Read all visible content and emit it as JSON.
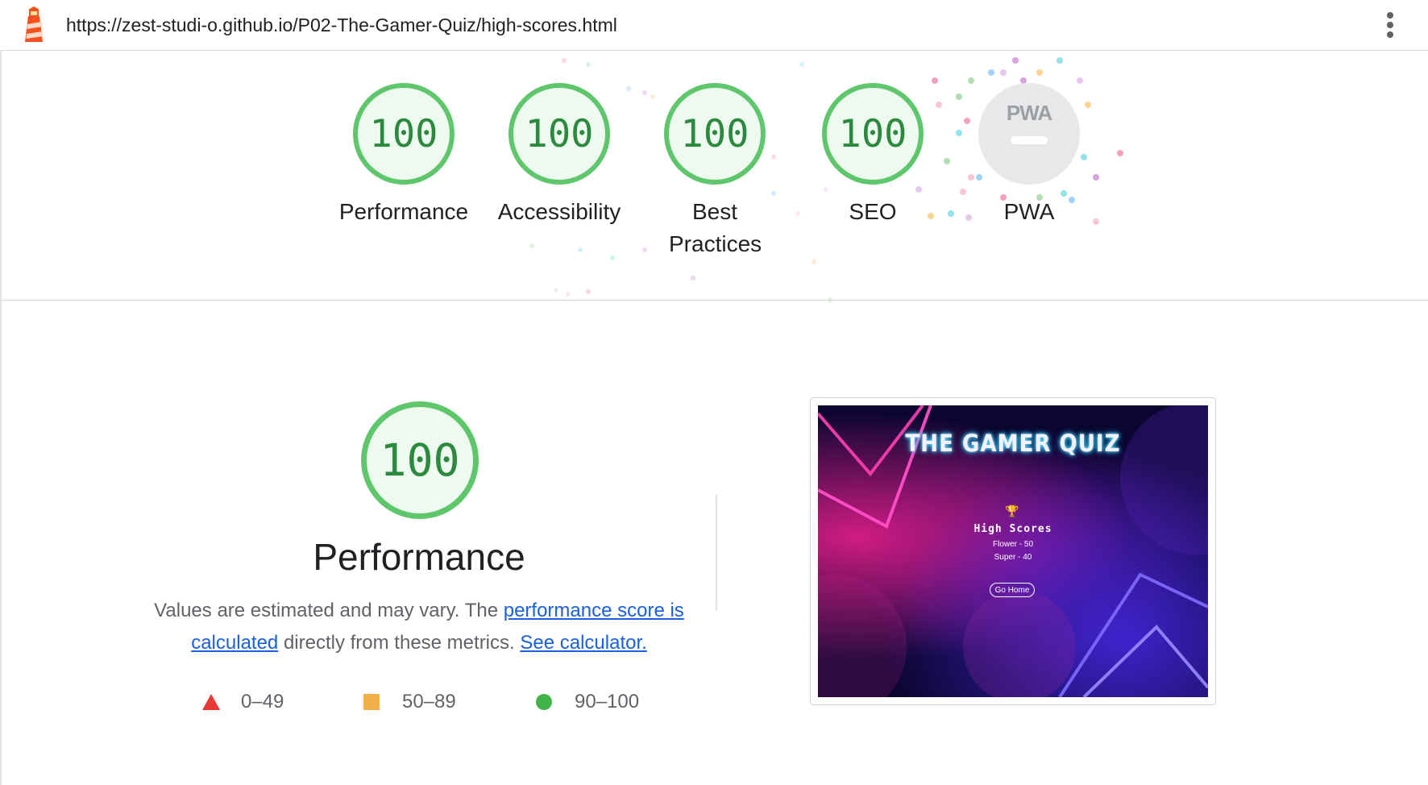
{
  "header": {
    "url": "https://zest-studi-o.github.io/P02-The-Gamer-Quiz/high-scores.html"
  },
  "gauges": [
    {
      "score": "100",
      "label": "Performance"
    },
    {
      "score": "100",
      "label": "Accessibility"
    },
    {
      "score": "100",
      "label": "Best Practices"
    },
    {
      "score": "100",
      "label": "SEO"
    }
  ],
  "pwa": {
    "badge_text": "PWA",
    "label": "PWA"
  },
  "performance": {
    "score": "100",
    "title": "Performance",
    "desc_part1": "Values are estimated and may vary. The ",
    "link_score": "performance score is calculated",
    "desc_part2": " directly from these metrics. ",
    "link_calculator": "See calculator."
  },
  "legend": [
    {
      "range": "0–49",
      "color": "#e53935"
    },
    {
      "range": "50–89",
      "color": "#f2b04a"
    },
    {
      "range": "90–100",
      "color": "#42b549"
    }
  ],
  "screenshot": {
    "title": "THE GAMER QUIZ",
    "heading": "High Scores",
    "scores": [
      "Flower - 50",
      "Super - 40"
    ],
    "button": "Go Home"
  },
  "colors": {
    "pass_green": "#5ec66b",
    "score_text": "#2b8a3e",
    "link_blue": "#1a5fe0"
  }
}
